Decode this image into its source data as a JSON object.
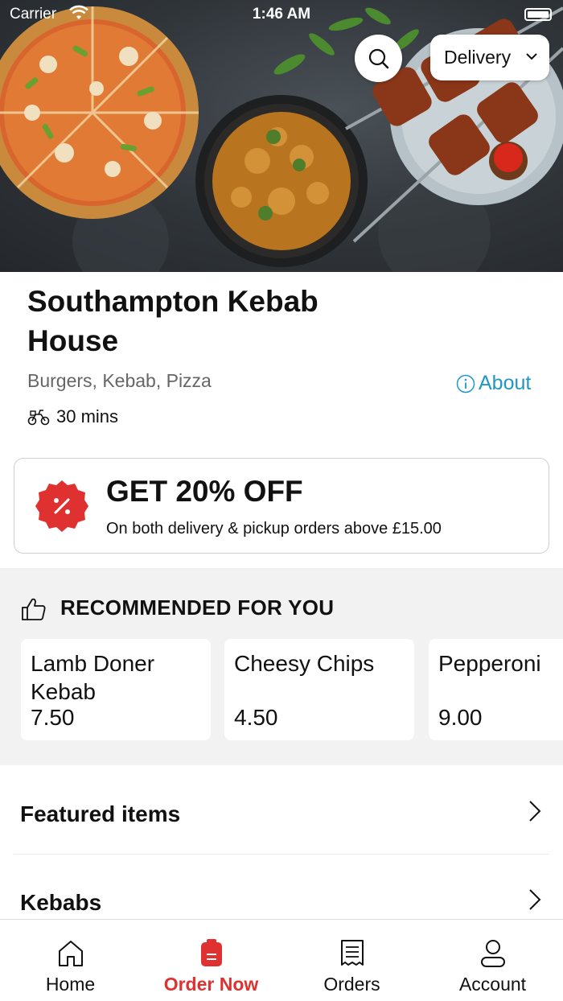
{
  "status_bar": {
    "carrier": "Carrier",
    "time": "1:46 AM"
  },
  "header": {
    "search_icon": "search-icon",
    "order_mode": "Delivery"
  },
  "restaurant": {
    "name": "Southampton Kebab House",
    "cuisines": "Burgers, Kebab, Pizza",
    "about_label": "About",
    "delivery_time": "30 mins"
  },
  "offer": {
    "headline": "GET 20% OFF",
    "details": "On both delivery & pickup orders above £15.00",
    "badge_icon": "percent-badge-icon"
  },
  "recommended": {
    "title": "RECOMMENDED FOR YOU",
    "items": [
      {
        "name": "Lamb Doner Kebab",
        "price": "7.50"
      },
      {
        "name": "Cheesy Chips",
        "price": "4.50"
      },
      {
        "name": "Pepperoni",
        "price": "9.00"
      }
    ]
  },
  "menu_sections": [
    {
      "label": "Featured items"
    },
    {
      "label": "Kebabs"
    }
  ],
  "tabbar": {
    "tabs": [
      {
        "label": "Home",
        "icon": "home-icon"
      },
      {
        "label": "Order Now",
        "icon": "order-icon"
      },
      {
        "label": "Orders",
        "icon": "receipt-icon"
      },
      {
        "label": "Account",
        "icon": "user-icon"
      }
    ],
    "active_index": 1,
    "active_color": "#e03131"
  },
  "colors": {
    "accent": "#e03131",
    "link": "#2196c9"
  }
}
